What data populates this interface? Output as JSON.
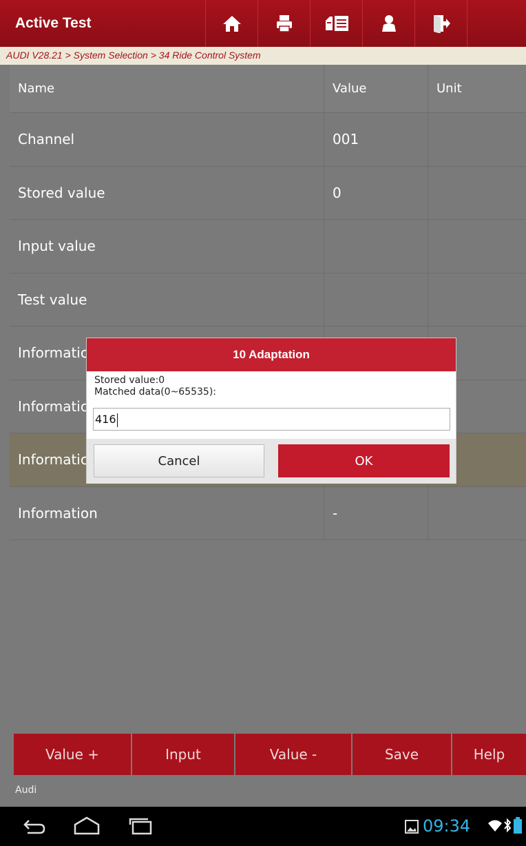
{
  "header": {
    "title": "Active Test",
    "icons": [
      "home-icon",
      "print-icon",
      "report-icon",
      "user-icon",
      "exit-icon"
    ]
  },
  "breadcrumb": "AUDI V28.21 > System Selection > 34 Ride Control System",
  "table": {
    "columns": {
      "name": "Name",
      "value": "Value",
      "unit": "Unit"
    },
    "rows": [
      {
        "name": "Channel",
        "value": "001",
        "unit": ""
      },
      {
        "name": "Stored value",
        "value": "0",
        "unit": ""
      },
      {
        "name": "Input value",
        "value": "",
        "unit": ""
      },
      {
        "name": "Test value",
        "value": "",
        "unit": ""
      },
      {
        "name": "Informatic",
        "value": "",
        "unit": ""
      },
      {
        "name": "Informatic",
        "value": "",
        "unit": ""
      },
      {
        "name": "Informatic",
        "value": "",
        "unit": ""
      },
      {
        "name": "Information",
        "value": "-",
        "unit": ""
      }
    ]
  },
  "toolbar": {
    "value_plus": "Value +",
    "input": "Input",
    "value_minus": "Value -",
    "save": "Save",
    "help": "Help"
  },
  "status": {
    "brand": "Audi"
  },
  "dialog": {
    "title": "10 Adaptation",
    "stored_line": "Stored value:0",
    "matched_line": "Matched data(0~65535):",
    "input_value": "416",
    "cancel_label": "Cancel",
    "ok_label": "OK"
  },
  "system_bar": {
    "time": "09:34"
  },
  "colors": {
    "brand_red": "#a8121c",
    "dialog_red": "#c32030",
    "clock_blue": "#33b5e5"
  }
}
